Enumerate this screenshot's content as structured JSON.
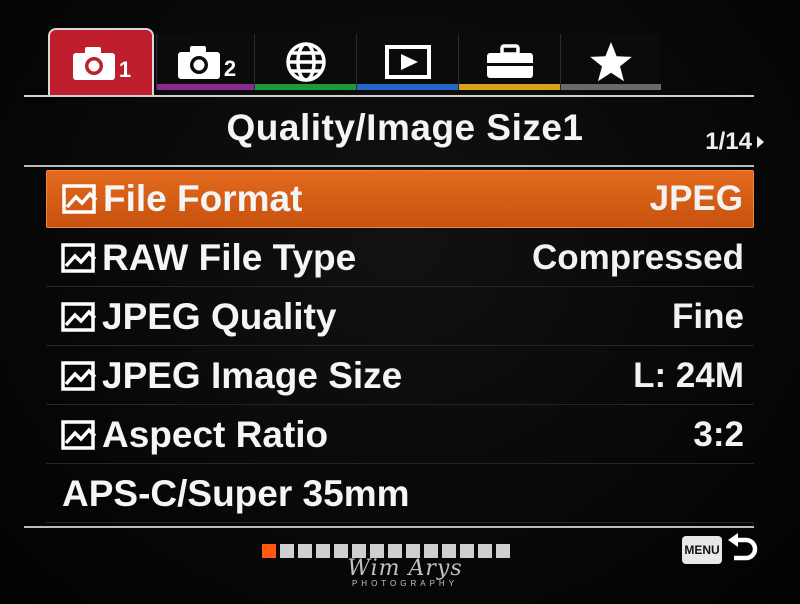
{
  "tabs": [
    {
      "name": "camera-settings-1",
      "icon": "camera-icon",
      "number": "1",
      "stripe": "#bf1f2c",
      "active": true
    },
    {
      "name": "camera-settings-2",
      "icon": "camera-icon",
      "number": "2",
      "stripe": "#8a2a8f",
      "active": false
    },
    {
      "name": "network",
      "icon": "globe-icon",
      "number": "",
      "stripe": "#1f9a3a",
      "active": false
    },
    {
      "name": "playback",
      "icon": "playback-icon",
      "number": "",
      "stripe": "#2567c8",
      "active": false
    },
    {
      "name": "setup",
      "icon": "toolbox-icon",
      "number": "",
      "stripe": "#d9a21c",
      "active": false
    },
    {
      "name": "my-menu",
      "icon": "star-icon",
      "number": "",
      "stripe": "#6a6a6a",
      "active": false
    }
  ],
  "header": {
    "title": "Quality/Image Size1",
    "page_indicator": "1/14"
  },
  "menu": {
    "items": [
      {
        "label": "File Format",
        "value": "JPEG",
        "icon": "still-image-icon",
        "selected": true
      },
      {
        "label": "RAW File Type",
        "value": "Compressed",
        "icon": "still-image-icon",
        "selected": false
      },
      {
        "label": "JPEG Quality",
        "value": "Fine",
        "icon": "still-image-icon",
        "selected": false
      },
      {
        "label": "JPEG Image Size",
        "value": "L: 24M",
        "icon": "still-image-icon",
        "selected": false
      },
      {
        "label": "Aspect Ratio",
        "value": "3:2",
        "icon": "still-image-icon",
        "selected": false
      },
      {
        "label": "APS-C/Super 35mm",
        "value": "",
        "icon": "",
        "selected": false
      }
    ]
  },
  "pagination": {
    "total": 14,
    "current": 1,
    "active_color": "#ff5a10"
  },
  "footer": {
    "menu_label": "MENU",
    "return_icon": "return-icon"
  },
  "watermark": {
    "text": "Wim Arys",
    "subtitle": "PHOTOGRAPHY"
  },
  "colors": {
    "selected_row": "#e36a1c",
    "accent_red": "#bf1f2c"
  }
}
